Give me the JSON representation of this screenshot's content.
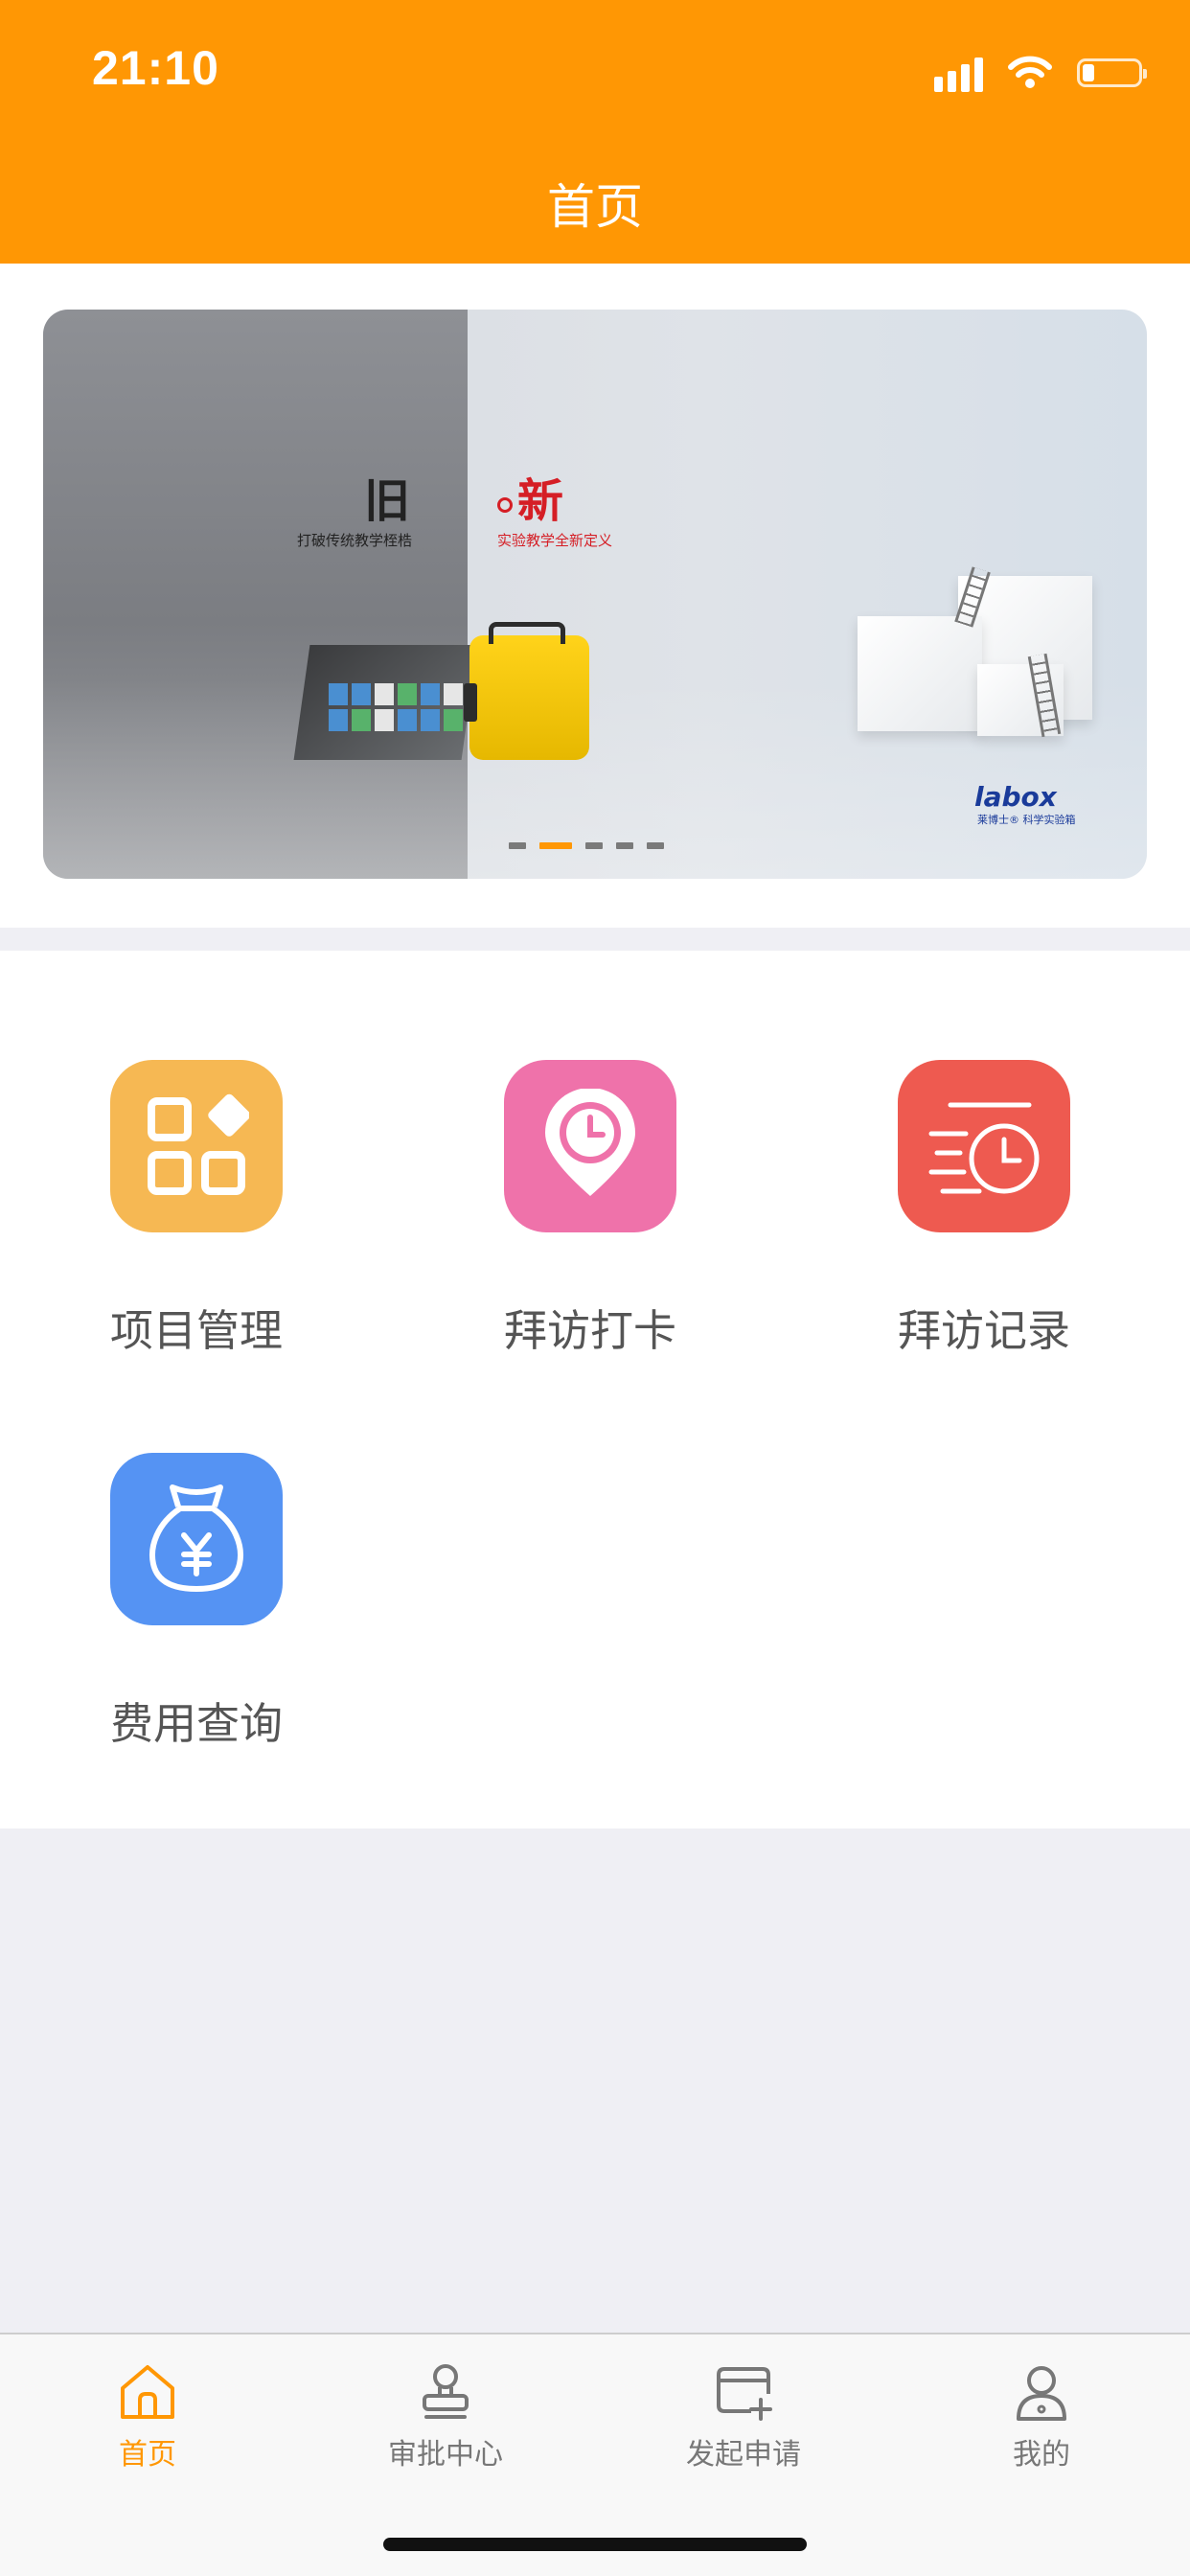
{
  "status_bar": {
    "time": "21:10",
    "battery_level": 0.2
  },
  "header": {
    "title": "首页"
  },
  "banner": {
    "old_word": "旧",
    "old_sub": "打破传统教学桎梏",
    "new_word": "新",
    "new_sub": "实验教学全新定义",
    "brand": "labox",
    "brand_sub": "莱博士® 科学实验箱",
    "page_count": 5,
    "active_page": 2
  },
  "grid": {
    "items": [
      {
        "label": "项目管理",
        "icon": "apps-grid-icon",
        "color": "#f6b853"
      },
      {
        "label": "拜访打卡",
        "icon": "location-clock-icon",
        "color": "#ef72aa"
      },
      {
        "label": "拜访记录",
        "icon": "history-clock-icon",
        "color": "#ee5a50"
      },
      {
        "label": "费用查询",
        "icon": "money-bag-icon",
        "color": "#5593f3"
      }
    ]
  },
  "tabbar": {
    "items": [
      {
        "label": "首页",
        "icon": "home-icon",
        "active": true
      },
      {
        "label": "审批中心",
        "icon": "stamp-icon",
        "active": false
      },
      {
        "label": "发起申请",
        "icon": "new-application-icon",
        "active": false
      },
      {
        "label": "我的",
        "icon": "profile-icon",
        "active": false
      }
    ],
    "active_color": "#ff9704",
    "inactive_color": "#777777"
  },
  "colors": {
    "brand": "#ff9704",
    "page_bg": "#efeff4"
  }
}
